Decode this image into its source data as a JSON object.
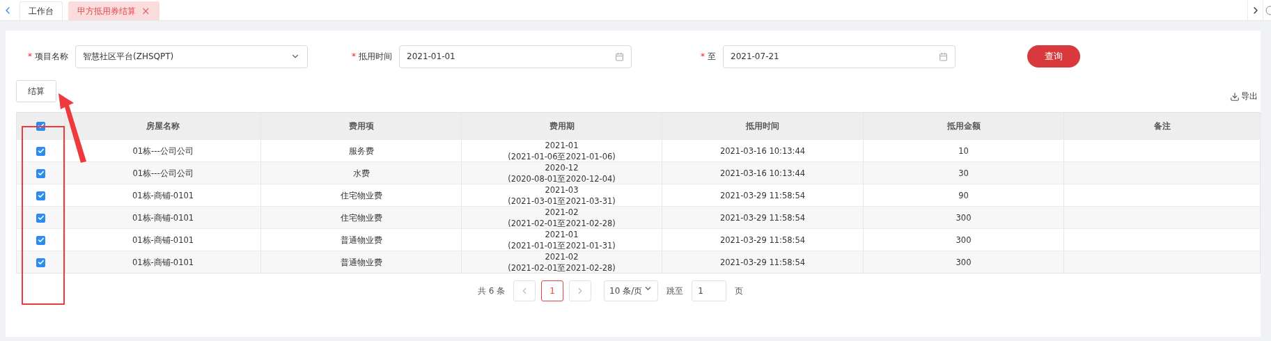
{
  "tabs": [
    {
      "label": "工作台",
      "selected": false,
      "closable": false
    },
    {
      "label": "甲方抵用券结算",
      "selected": true,
      "closable": true
    }
  ],
  "close_glyph": "×",
  "form": [
    {
      "kind": "select",
      "label": "项目名称",
      "required": true,
      "value": "智慧社区平台(ZHSQPT)"
    },
    {
      "kind": "date",
      "label": "抵用时间",
      "required": true,
      "value": "2021-01-01"
    },
    {
      "kind": "date",
      "label": "至",
      "required": true,
      "value": "2021-07-21"
    }
  ],
  "required_mark": "*",
  "query_button": "查询",
  "settle_button": "结算",
  "export_link": "导出",
  "table": {
    "all_checked": true,
    "columns": [
      "房屋名称",
      "费用项",
      "费用期",
      "抵用时间",
      "抵用金额",
      "备注"
    ],
    "rows": [
      {
        "checked": true,
        "cells": [
          "01栋---公司公司",
          "服务费",
          "2021-01\n(2021-01-06至2021-01-06)",
          "2021-03-16 10:13:44",
          "10",
          ""
        ]
      },
      {
        "checked": true,
        "cells": [
          "01栋---公司公司",
          "水费",
          "2020-12\n(2020-08-01至2020-12-04)",
          "2021-03-16 10:13:44",
          "30",
          ""
        ]
      },
      {
        "checked": true,
        "cells": [
          "01栋-商铺-0101",
          "住宅物业费",
          "2021-03\n(2021-03-01至2021-03-31)",
          "2021-03-29 11:58:54",
          "90",
          ""
        ]
      },
      {
        "checked": true,
        "cells": [
          "01栋-商铺-0101",
          "住宅物业费",
          "2021-02\n(2021-02-01至2021-02-28)",
          "2021-03-29 11:58:54",
          "300",
          ""
        ]
      },
      {
        "checked": true,
        "cells": [
          "01栋-商铺-0101",
          "普通物业费",
          "2021-01\n(2021-01-01至2021-01-31)",
          "2021-03-29 11:58:54",
          "300",
          ""
        ]
      },
      {
        "checked": true,
        "cells": [
          "01栋-商铺-0101",
          "普通物业费",
          "2021-02\n(2021-02-01至2021-02-28)",
          "2021-03-29 11:58:54",
          "300",
          ""
        ]
      }
    ]
  },
  "pagination": {
    "total": "共 6 条",
    "pages": [
      {
        "label": "1",
        "selected": true
      }
    ],
    "page_size": "10 条/页",
    "jump_label": "跳至",
    "jump_value": "1",
    "page_suffix": "页"
  }
}
